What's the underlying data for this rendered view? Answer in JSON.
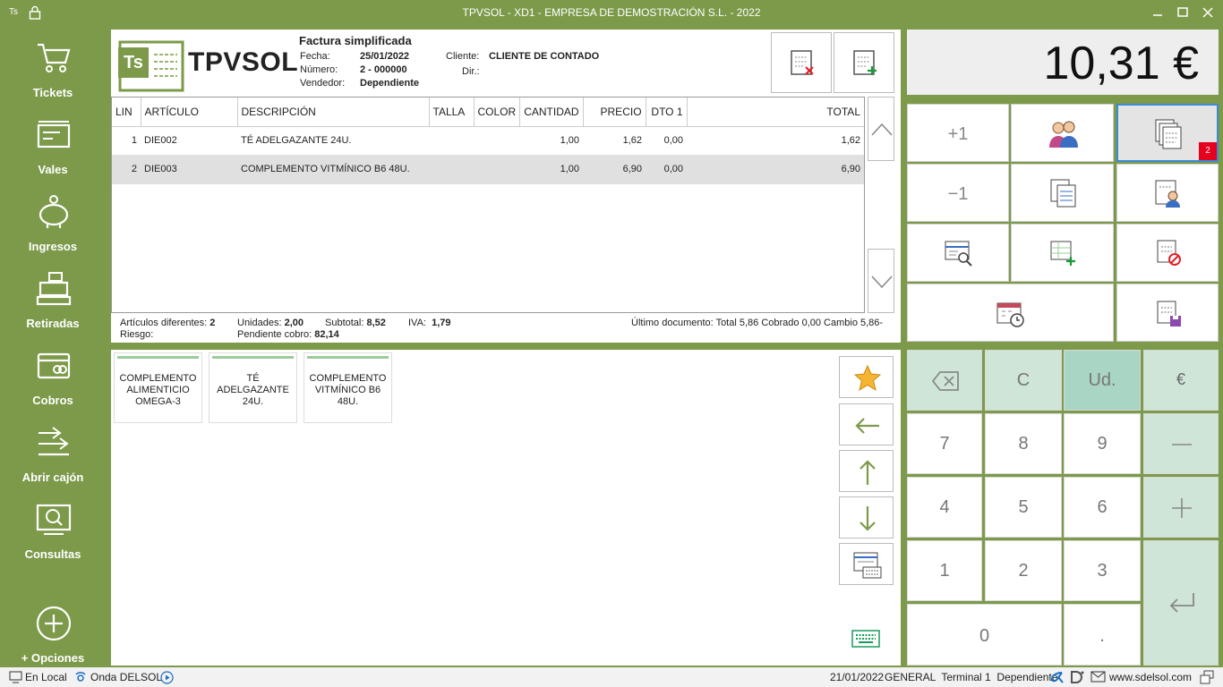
{
  "titlebar": {
    "app_short": "Ts",
    "title": "TPVSOL - XD1 - EMPRESA DE DEMOSTRACIÓN S.L. - 2022"
  },
  "sidebar": {
    "items": [
      {
        "label": "Tickets",
        "icon": "cart-icon"
      },
      {
        "label": "Vales",
        "icon": "voucher-icon"
      },
      {
        "label": "Ingresos",
        "icon": "piggy-bank-icon"
      },
      {
        "label": "Retiradas",
        "icon": "cash-register-icon"
      },
      {
        "label": "Cobros",
        "icon": "card-icon"
      },
      {
        "label": "Abrir cajón",
        "icon": "open-drawer-icon"
      },
      {
        "label": "Consultas",
        "icon": "search-monitor-icon"
      },
      {
        "label": "+ Opciones",
        "icon": "plus-circle-icon"
      }
    ]
  },
  "ticket": {
    "logo_text": "TPVSOL",
    "logo_badge": "Ts",
    "doc_type": "Factura simplificada",
    "fecha_label": "Fecha:",
    "fecha": "25/01/2022",
    "numero_label": "Número:",
    "numero": "2 - 000000",
    "vendedor_label": "Vendedor:",
    "vendedor": "Dependiente",
    "cliente_label": "Cliente:",
    "cliente": "CLIENTE DE CONTADO",
    "dir_label": "Dir.:",
    "columns": [
      "LIN",
      "ARTÍCULO",
      "DESCRIPCIÓN",
      "TALLA",
      "COLOR",
      "CANTIDAD",
      "PRECIO",
      "DTO 1",
      "TOTAL"
    ],
    "rows": [
      {
        "lin": "1",
        "articulo": "DIE002",
        "descripcion": "TÉ ADELGAZANTE 24U.",
        "talla": "",
        "color": "",
        "cantidad": "1,00",
        "precio": "1,62",
        "dto": "0,00",
        "total": "1,62"
      },
      {
        "lin": "2",
        "articulo": "DIE003",
        "descripcion": "COMPLEMENTO VITMÍNICO B6 48U.",
        "talla": "",
        "color": "",
        "cantidad": "1,00",
        "precio": "6,90",
        "dto": "0,00",
        "total": "6,90"
      }
    ],
    "summary": {
      "articulos_label": "Artículos diferentes:",
      "articulos": "2",
      "unidades_label": "Unidades:",
      "unidades": "2,00",
      "subtotal_label": "Subtotal:",
      "subtotal": "8,52",
      "iva_label": "IVA:",
      "iva": "1,79",
      "riesgo_label": "Riesgo:",
      "pendiente_label": "Pendiente cobro:",
      "pendiente": "82,14",
      "ultimo": "Último documento: Total 5,86 Cobrado 0,00 Cambio 5,86-"
    }
  },
  "total_display": "10,31 €",
  "functions": {
    "plus_one": "+1",
    "minus_one": "−1",
    "badge_count": "2"
  },
  "products": [
    {
      "label": "COMPLEMENTO ALIMENTICIO OMEGA-3"
    },
    {
      "label": "TÉ ADELGAZANTE 24U."
    },
    {
      "label": "COMPLEMENTO VITMÍNICO B6 48U."
    }
  ],
  "keypad": {
    "clear": "C",
    "units": "Ud.",
    "euro": "€",
    "k7": "7",
    "k8": "8",
    "k9": "9",
    "k4": "4",
    "k5": "5",
    "k6": "6",
    "k1": "1",
    "k2": "2",
    "k3": "3",
    "k0": "0",
    "dot": "."
  },
  "status": {
    "local": "En Local",
    "onda": "Onda DELSOL",
    "date": "21/01/2022",
    "info": "GENERAL  Terminal 1  Dependiente",
    "web": "www.sdelsol.com"
  },
  "colors": {
    "brand_green": "#7c9a4a",
    "keypad_green": "#cfe5d8",
    "keypad_green_dark": "#a9d5c4",
    "badge_red": "#e6001e"
  }
}
